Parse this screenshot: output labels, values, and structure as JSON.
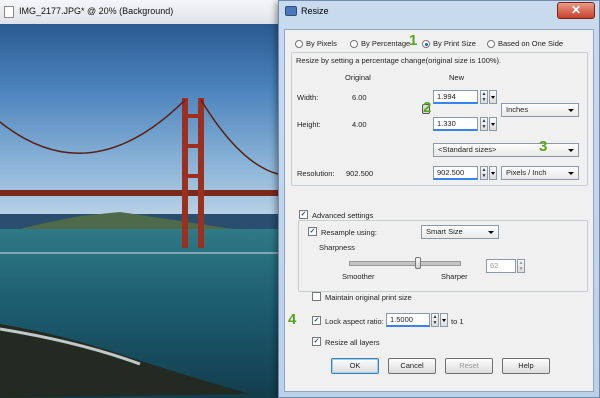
{
  "image_window": {
    "title": "IMG_2177.JPG* @  20% (Background)"
  },
  "dialog": {
    "title": "Resize",
    "close_label": "✕",
    "modes": [
      {
        "label": "By Pixels",
        "selected": false
      },
      {
        "label": "By Percentage",
        "selected": false
      },
      {
        "label": "By Print Size",
        "selected": true
      },
      {
        "label": "Based on One Side",
        "selected": false
      }
    ],
    "description": "Resize by setting a percentage change(original size is 100%).",
    "col_original": "Original",
    "col_new": "New",
    "width": {
      "label": "Width:",
      "original": "6.00",
      "new": "1.994"
    },
    "height": {
      "label": "Height:",
      "original": "4.00",
      "new": "1.330"
    },
    "units": "Inches",
    "standard_sizes": "<Standard sizes>",
    "resolution": {
      "label": "Resolution:",
      "original": "902.500",
      "new": "902.500",
      "units": "Pixels / Inch"
    },
    "advanced": {
      "label": "Advanced settings",
      "checked": true,
      "resample_label": "Resample using:",
      "resample_checked": true,
      "resample_method": "Smart Size",
      "sharpness_label": "Sharpness",
      "sharpness_value": "62",
      "sharpness_level": 0.62,
      "smoother_label": "Smoother",
      "sharper_label": "Sharper"
    },
    "maintain_print_size": {
      "label": "Maintain original print size",
      "checked": false
    },
    "lock_aspect": {
      "label": "Lock aspect ratio:",
      "checked": true,
      "value": "1.5000",
      "suffix": "to 1"
    },
    "resize_all_layers": {
      "label": "Resize all layers",
      "checked": true
    },
    "buttons": {
      "ok": "OK",
      "cancel": "Cancel",
      "reset": "Reset",
      "help": "Help"
    },
    "annotations": [
      "1",
      "2",
      "3",
      "4"
    ]
  }
}
